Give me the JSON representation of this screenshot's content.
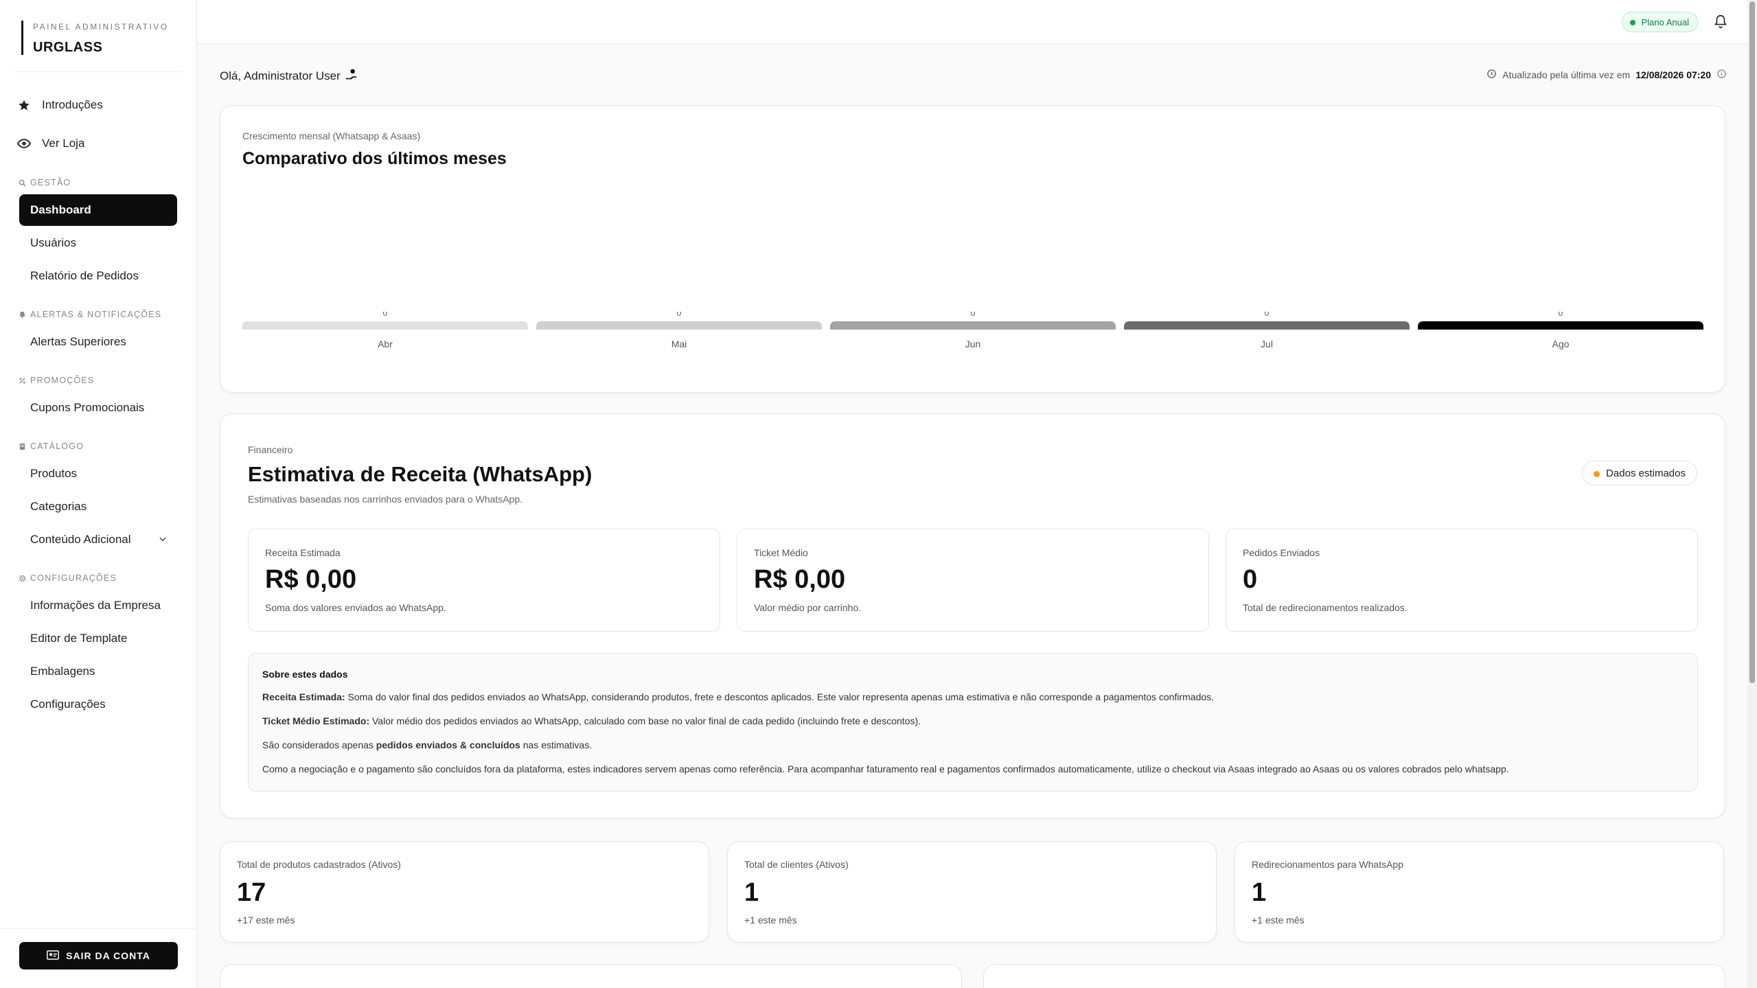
{
  "sidebar": {
    "brand_sub": "PAINEL ADMINISTRATIVO",
    "brand_name": "URGLASS",
    "top_links": [
      {
        "label": "Introduções",
        "icon": "star-icon"
      },
      {
        "label": "Ver Loja",
        "icon": "eye-icon"
      }
    ],
    "sections": {
      "gestao": "GESTÃO",
      "alertas": "ALERTAS & NOTIFICAÇÕES",
      "promocoes": "PROMOÇÕES",
      "catalogo": "CATÁLOGO",
      "configuracoes": "CONFIGURAÇÕES"
    },
    "items": {
      "dashboard": "Dashboard",
      "usuarios": "Usuários",
      "relatorio": "Relatório de Pedidos",
      "alertas_superiores": "Alertas Superiores",
      "cupons": "Cupons Promocionais",
      "produtos": "Produtos",
      "categorias": "Categorias",
      "conteudo": "Conteúdo Adicional",
      "info_empresa": "Informações da Empresa",
      "editor_template": "Editor de Template",
      "embalagens": "Embalagens",
      "configuracoes": "Configurações"
    },
    "logout_label": "SAIR DA CONTA"
  },
  "header": {
    "plan_badge": "Plano Anual"
  },
  "greeting": "Olá, Administrator User",
  "updated": {
    "prefix": "Atualizado pela última vez em",
    "datetime": "12/08/2026 07:20"
  },
  "chart_card": {
    "eyebrow": "Crescimento mensal (Whatsapp & Asaas)",
    "title": "Comparativo dos últimos meses"
  },
  "chart_data": {
    "type": "bar",
    "categories": [
      "Abr",
      "Mai",
      "Jun",
      "Jul",
      "Ago"
    ],
    "values": [
      0,
      0,
      0,
      0,
      0
    ],
    "data_labels": [
      "0",
      "0",
      "0",
      "0",
      "0"
    ],
    "bar_colors": [
      "#e0e0e0",
      "#cfcfcf",
      "#a3a3a3",
      "#6b6b6b",
      "#000000"
    ],
    "title": "Comparativo dos últimos meses"
  },
  "financeiro": {
    "eyebrow": "Financeiro",
    "title": "Estimativa de Receita (WhatsApp)",
    "subtitle": "Estimativas baseadas nos carrinhos enviados para o WhatsApp.",
    "badge": "Dados estimados",
    "metrics": [
      {
        "label": "Receita Estimada",
        "value": "R$ 0,00",
        "desc": "Soma dos valores enviados ao WhatsApp."
      },
      {
        "label": "Ticket Médio",
        "value": "R$ 0,00",
        "desc": "Valor médio por carrinho."
      },
      {
        "label": "Pedidos Enviados",
        "value": "0",
        "desc": "Total de redirecionamentos realizados."
      }
    ],
    "about": {
      "heading": "Sobre estes dados",
      "receita_label": "Receita Estimada:",
      "receita_text": " Soma do valor final dos pedidos enviados ao WhatsApp, considerando produtos, frete e descontos aplicados. Este valor representa apenas uma estimativa e não corresponde a pagamentos confirmados.",
      "ticket_label": "Ticket Médio Estimado:",
      "ticket_text": " Valor médio dos pedidos enviados ao WhatsApp, calculado com base no valor final de cada pedido (incluindo frete e descontos).",
      "considered_pre": "São considerados apenas ",
      "considered_bold": "pedidos enviados & concluídos",
      "considered_post": " nas estimativas.",
      "note": "Como a negociação e o pagamento são concluídos fora da plataforma, estes indicadores servem apenas como referência. Para acompanhar faturamento real e pagamentos confirmados automaticamente, utilize o checkout via Asaas integrado ao Asaas ou os valores cobrados pelo whatsapp."
    }
  },
  "stats": [
    {
      "label": "Total de produtos cadastrados (Ativos)",
      "value": "17",
      "desc": "+17 este mês"
    },
    {
      "label": "Total de clientes (Ativos)",
      "value": "1",
      "desc": "+1 este mês"
    },
    {
      "label": "Redirecionamentos para WhatsApp",
      "value": "1",
      "desc": "+1 este mês"
    }
  ]
}
